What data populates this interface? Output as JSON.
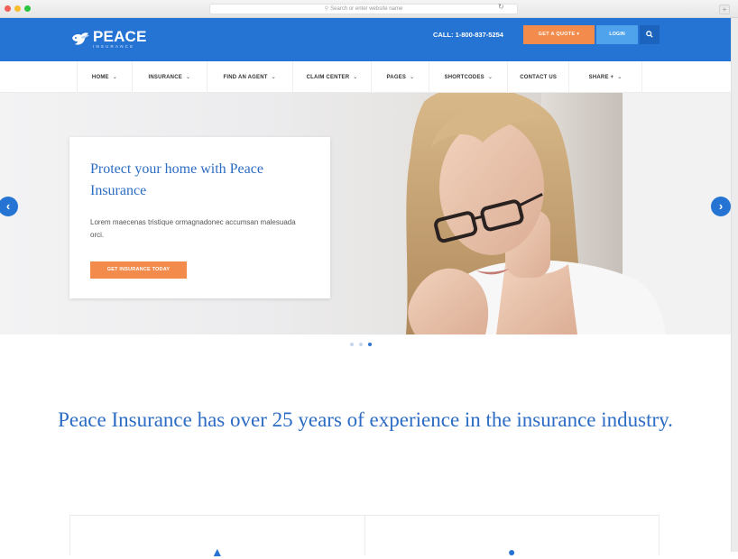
{
  "browser": {
    "address_placeholder": "Search or enter website name"
  },
  "header": {
    "logo_name": "PEACE",
    "logo_sub": "INSURANCE",
    "call": "CALL: 1-800-837-5254",
    "quote_label": "GET A QUOTE",
    "login_label": "LOGIN"
  },
  "nav": {
    "items": [
      {
        "label": "HOME"
      },
      {
        "label": "INSURANCE"
      },
      {
        "label": "FIND AN AGENT"
      },
      {
        "label": "CLAIM CENTER"
      },
      {
        "label": "PAGES"
      },
      {
        "label": "SHORTCODES"
      },
      {
        "label": "CONTACT US"
      },
      {
        "label": "SHARE +"
      }
    ]
  },
  "hero": {
    "title": "Protect your home with Peace Insurance",
    "description": "Lorem maecenas tristique ormagnadonec accumsan malesuada orci.",
    "button_label": "GET INSURANCE TODAY",
    "slides_total": 3,
    "active_slide": 3
  },
  "headline": "Peace Insurance has over 25 years of experience in the insurance industry.",
  "colors": {
    "primary": "#2574d4",
    "accent": "#f28b4b",
    "login": "#4ea3ec",
    "heading": "#2c6cc4"
  },
  "icons": [
    "search-icon",
    "reload-icon",
    "bird-logo-icon",
    "chevron-down-icon",
    "arrow-left-icon",
    "arrow-right-icon"
  ]
}
